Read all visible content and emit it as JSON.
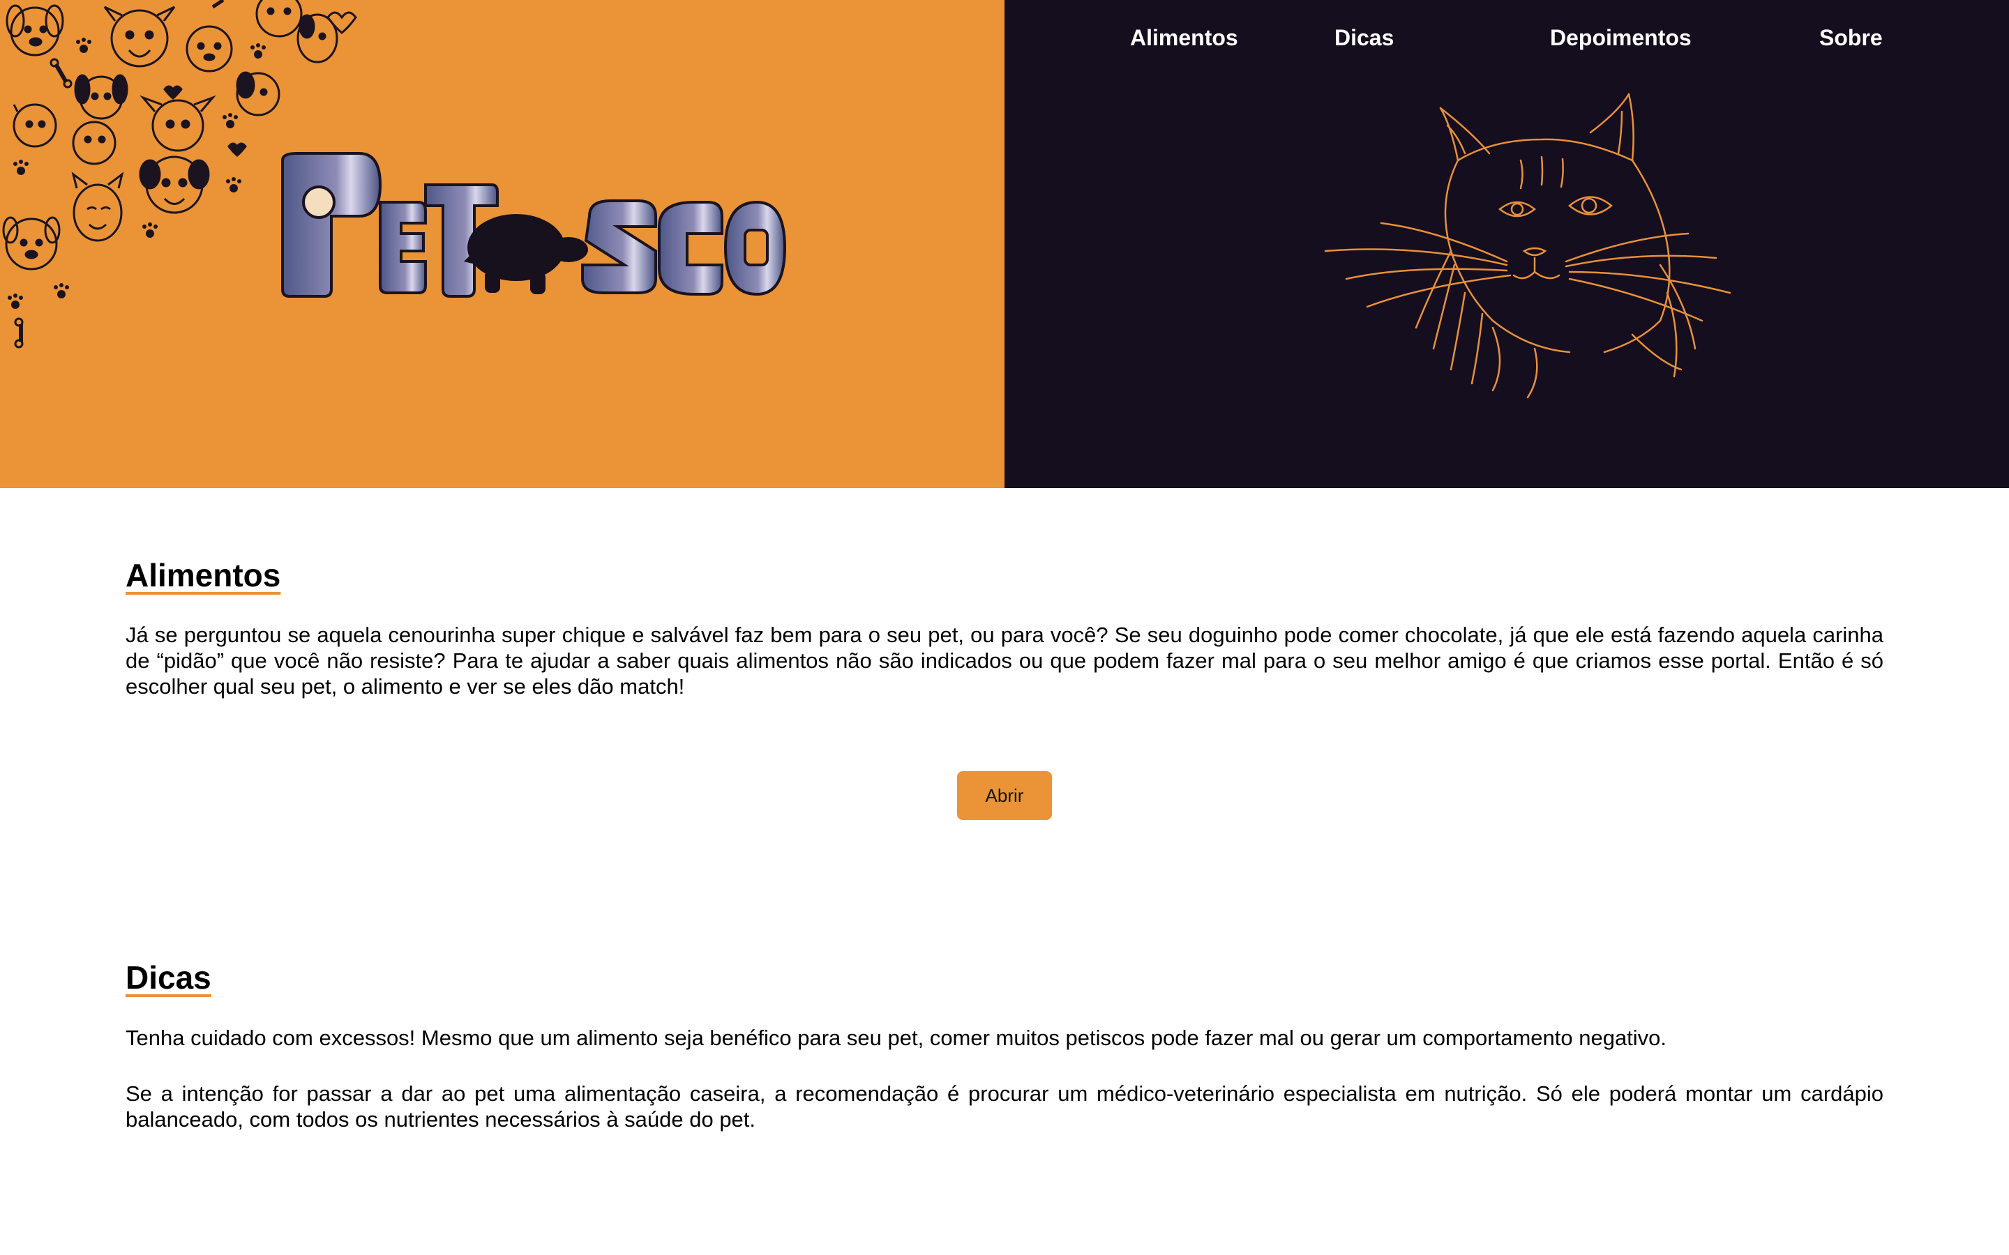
{
  "header": {
    "logo_alt": "PETISCO",
    "nav": [
      {
        "label": "Alimentos"
      },
      {
        "label": "Dicas"
      },
      {
        "label": "Depoimentos"
      },
      {
        "label": "Sobre"
      }
    ]
  },
  "sections": {
    "alimentos": {
      "title": "Alimentos",
      "text": "Já se perguntou se aquela cenourinha super chique e salvável faz bem para o seu pet, ou para você? Se seu doguinho pode comer chocolate, já que ele está fazendo aquela carinha de “pidão” que você não resiste? Para te ajudar a saber quais alimentos não são indicados ou que podem fazer mal para o seu melhor amigo é que criamos esse portal. Então é só escolher qual seu pet, o alimento e ver se eles dão match!",
      "button_label": "Abrir"
    },
    "dicas": {
      "title": "Dicas",
      "tip1": "Tenha cuidado com excessos! Mesmo que um alimento seja benéfico para seu pet, comer muitos petiscos pode fazer mal ou gerar um comportamento negativo.",
      "tip2": "Se a intenção for passar a dar ao pet uma alimentação caseira, a recomendação é procurar um médico-veterinário especialista em nutrição. Só ele poderá montar um cardápio balanceado, com todos os nutrientes necessários à saúde do pet."
    }
  },
  "colors": {
    "accent_orange": "#EA9337",
    "dark_panel": "#150E1E",
    "logo_gradient": [
      "#4A5384",
      "#D8D4EA"
    ]
  },
  "icons": [
    "dog-doodles-icon",
    "turtle-icon",
    "cat-line-art-icon"
  ]
}
